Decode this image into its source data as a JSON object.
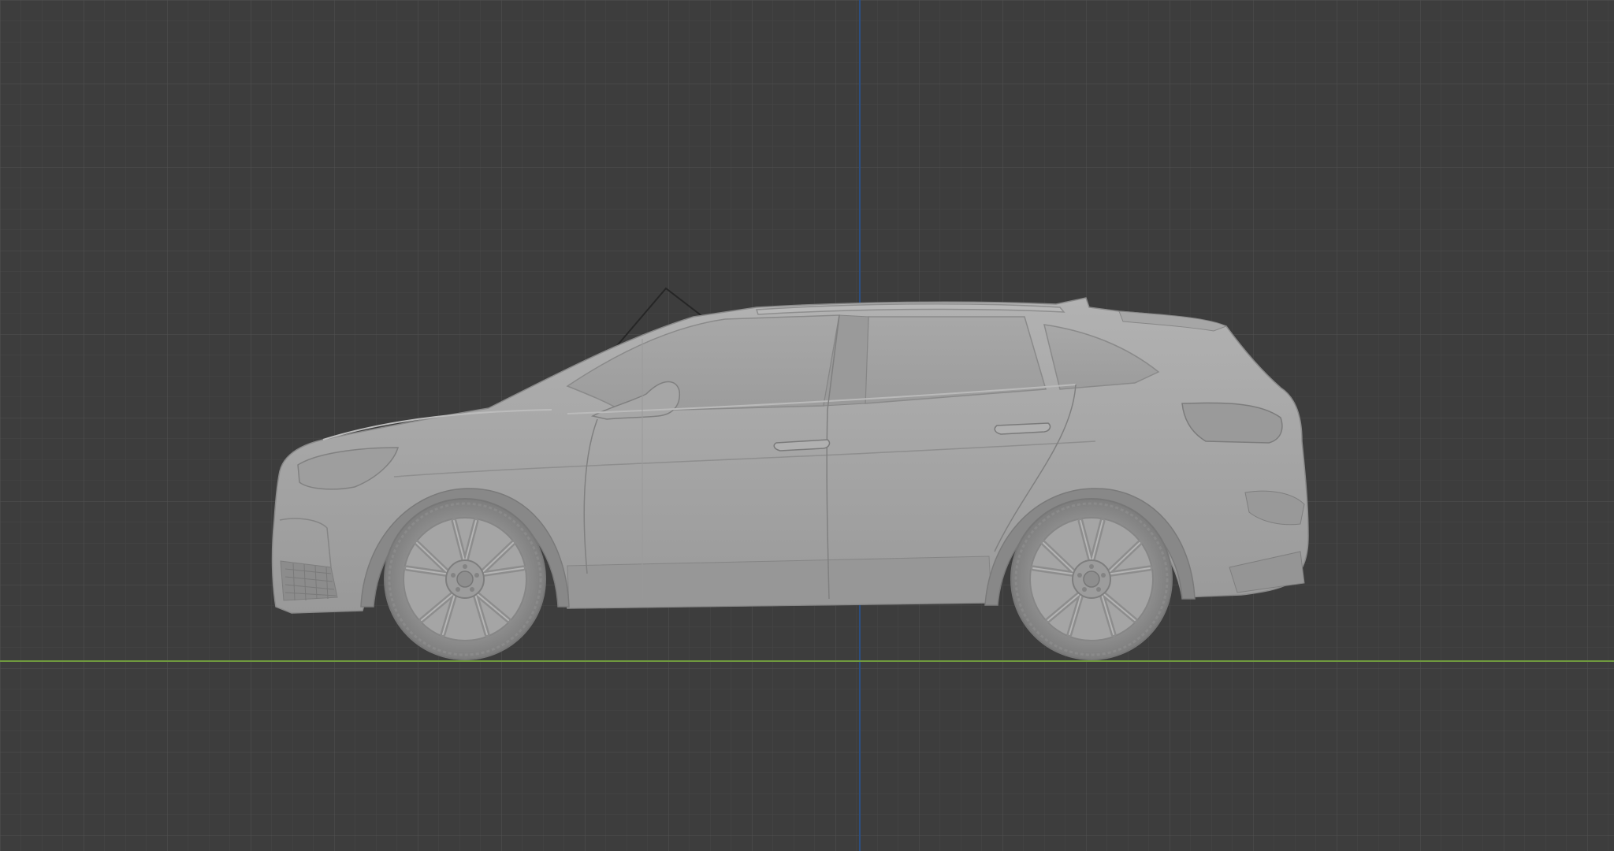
{
  "viewport": {
    "view": "side-orthographic",
    "background_color": "#3d3d3d",
    "grid_minor_color": "#474747",
    "grid_major_color": "#535353",
    "floor_axis_color": "#6f9a3e",
    "vertical_axis_color": "#2c4f82",
    "grid": true
  },
  "model": {
    "object": "suv-car-model",
    "shading": "solid-grey",
    "body_color": "#a3a3a3",
    "shadow_color": "#8a8a8a",
    "highlight_color": "#b4b4b4",
    "line_color": "#7c7c7c",
    "wheel_count": 2
  }
}
